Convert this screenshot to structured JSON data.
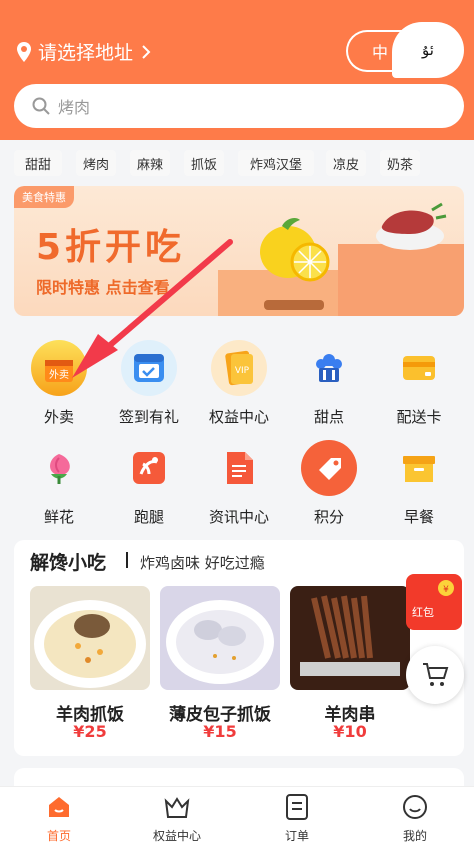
{
  "header": {
    "location_label": "请选择地址",
    "lang_zh": "中",
    "lang_ug": "ئۇ"
  },
  "search": {
    "placeholder": "烤肉"
  },
  "tags": [
    "甜甜",
    "烤肉",
    "麻辣",
    "抓饭",
    "炸鸡汉堡",
    "凉皮",
    "奶茶"
  ],
  "banner": {
    "badge": "美食特惠",
    "title": "5折开吃",
    "subtitle": "限时特惠 点击查看"
  },
  "icons": [
    {
      "label": "外卖",
      "icon": "takeout-bag-icon"
    },
    {
      "label": "签到有礼",
      "icon": "calendar-check-icon"
    },
    {
      "label": "权益中心",
      "icon": "vip-card-icon"
    },
    {
      "label": "甜点",
      "icon": "cupcake-icon"
    },
    {
      "label": "配送卡",
      "icon": "card-icon"
    },
    {
      "label": "鲜花",
      "icon": "flower-icon"
    },
    {
      "label": "跑腿",
      "icon": "errand-icon"
    },
    {
      "label": "资讯中心",
      "icon": "document-icon"
    },
    {
      "label": "积分",
      "icon": "tag-icon"
    },
    {
      "label": "早餐",
      "icon": "box-icon"
    }
  ],
  "section": {
    "title": "解馋小吃",
    "subtitle": "炸鸡卤味 好吃过瘾",
    "items": [
      {
        "name": "羊肉抓饭",
        "price": "¥25"
      },
      {
        "name": "薄皮包子抓饭",
        "price": "¥15"
      },
      {
        "name": "羊肉串",
        "price": "¥10"
      }
    ]
  },
  "redpacket_label": "红包",
  "tabbar": [
    {
      "label": "首页",
      "icon": "home-icon",
      "active": true
    },
    {
      "label": "权益中心",
      "icon": "crown-icon",
      "active": false
    },
    {
      "label": "订单",
      "icon": "order-icon",
      "active": false
    },
    {
      "label": "我的",
      "icon": "profile-icon",
      "active": false
    }
  ],
  "colors": {
    "brand": "#fe7b49",
    "price": "#f03c3c",
    "active_tab": "#fe6b2e"
  }
}
